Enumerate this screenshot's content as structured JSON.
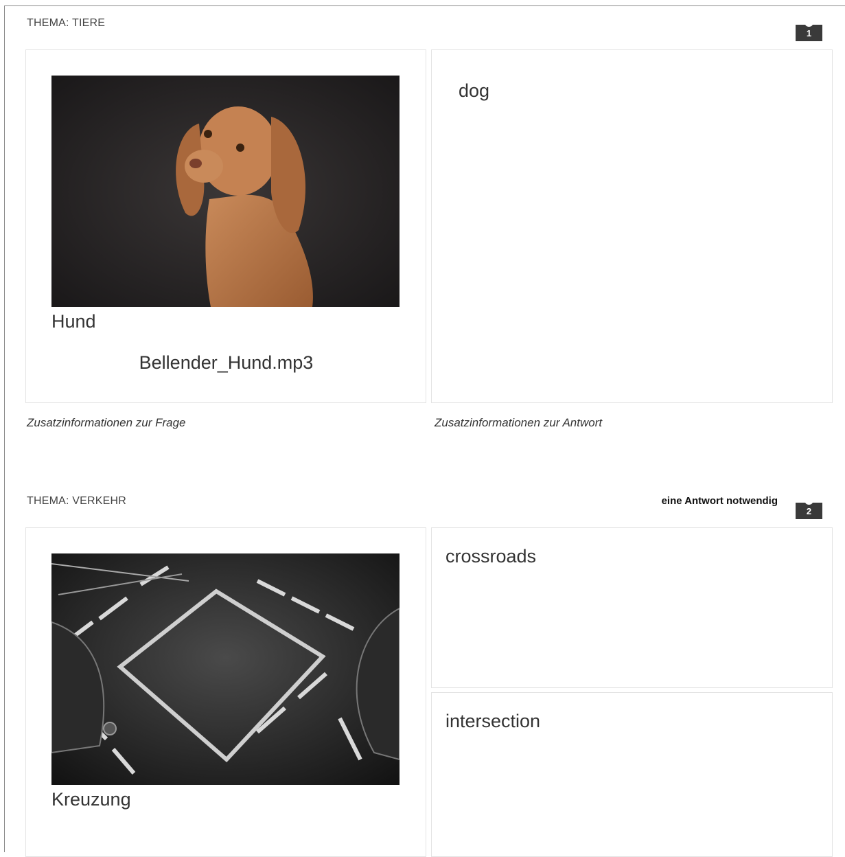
{
  "questions": [
    {
      "number": "1",
      "topic": "THEMA: TIERE",
      "image_label": "dog-photo",
      "caption": "Hund",
      "audio_file": "Bellender_Hund.mp3",
      "answers": [
        "dog"
      ],
      "question_info": "Zusatzinformationen zur Frage",
      "answer_info": "Zusatzinformationen zur Antwort"
    },
    {
      "number": "2",
      "topic": "THEMA: VERKEHR",
      "required_text": "eine Antwort notwendig",
      "image_label": "crossroads-photo",
      "caption": "Kreuzung",
      "answers": [
        "crossroads",
        "intersection"
      ]
    }
  ],
  "colors": {
    "badge": "#3a3a3a",
    "border": "#e3e3e3",
    "frame": "#8a8a8a"
  }
}
